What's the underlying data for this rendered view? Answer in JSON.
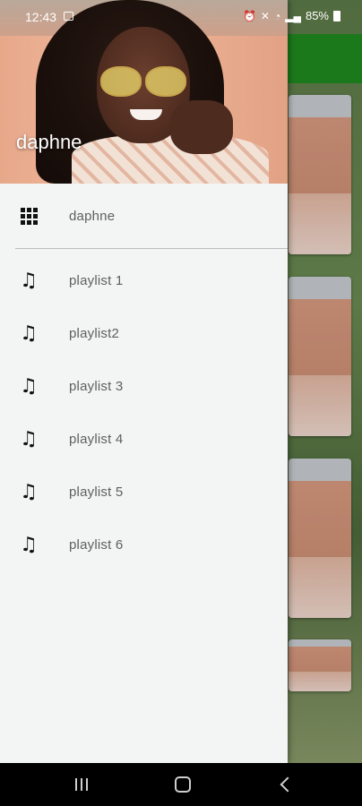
{
  "status_bar": {
    "time": "12:43",
    "battery": "85%"
  },
  "drawer": {
    "header_title": "daphne",
    "items": [
      {
        "label": "daphne",
        "icon": "grid-icon"
      },
      {
        "label": "playlist 1",
        "icon": "music-note-icon"
      },
      {
        "label": "playlist2",
        "icon": "music-note-icon"
      },
      {
        "label": "playlist 3",
        "icon": "music-note-icon"
      },
      {
        "label": "playlist 4",
        "icon": "music-note-icon"
      },
      {
        "label": "playlist 5",
        "icon": "music-note-icon"
      },
      {
        "label": "playlist 6",
        "icon": "music-note-icon"
      }
    ]
  },
  "nav_bar": {
    "buttons": [
      "recents-icon",
      "home-icon",
      "back-icon"
    ]
  },
  "colors": {
    "app_bar": "#1f8a1f",
    "drawer_bg": "#f2f5f3",
    "label_text": "#5f5f5f"
  }
}
